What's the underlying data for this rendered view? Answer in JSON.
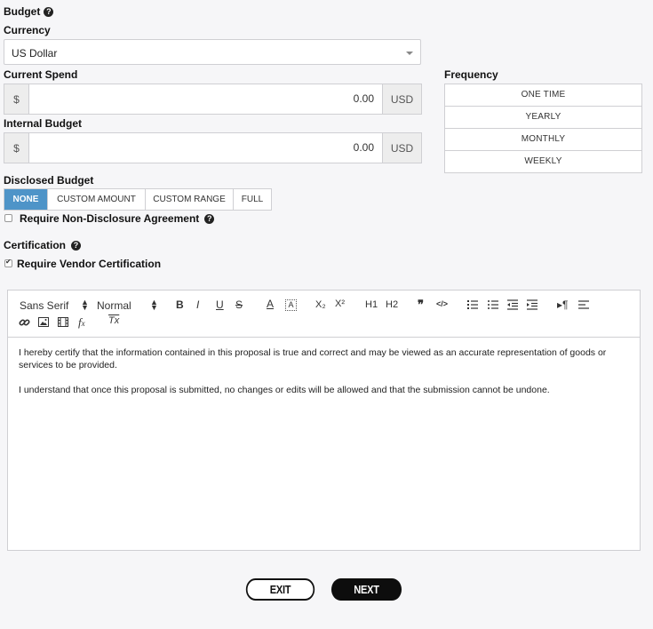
{
  "budget": {
    "title": "Budget",
    "help": "?"
  },
  "currency": {
    "label": "Currency",
    "selected": "US Dollar"
  },
  "current_spend": {
    "label": "Current Spend",
    "prefix": "$",
    "value": "0.00",
    "suffix": "USD"
  },
  "internal_budget": {
    "label": "Internal Budget",
    "prefix": "$",
    "value": "0.00",
    "suffix": "USD"
  },
  "frequency": {
    "label": "Frequency",
    "options": [
      "ONE TIME",
      "YEARLY",
      "MONTHLY",
      "WEEKLY"
    ]
  },
  "disclosed": {
    "label": "Disclosed Budget",
    "options": [
      "NONE",
      "CUSTOM AMOUNT",
      "CUSTOM RANGE",
      "FULL"
    ],
    "selected": "NONE"
  },
  "nda": {
    "label": "Require Non-Disclosure Agreement",
    "checked": false,
    "help": "?"
  },
  "certification": {
    "title": "Certification",
    "help": "?",
    "checkbox_label": "Require Vendor Certification",
    "checked": true
  },
  "toolbar": {
    "font": "Sans Serif",
    "size": "Normal",
    "bold": "B",
    "italic": "I",
    "underline": "U",
    "strike": "S",
    "color": "A",
    "subscript": "X₂",
    "superscript": "X²",
    "h1": "H1",
    "h2": "H2",
    "quote": "❞",
    "code": "</>",
    "clean": "Tx"
  },
  "editor": {
    "paragraphs": [
      "I hereby certify that the information contained in this proposal is true and correct and may be viewed as an accurate representation of goods or services to be provided.",
      "I understand that once this proposal is submitted, no changes or edits will be allowed and that the submission cannot be undone."
    ]
  },
  "actions": {
    "exit": "EXIT",
    "next": "NEXT"
  }
}
